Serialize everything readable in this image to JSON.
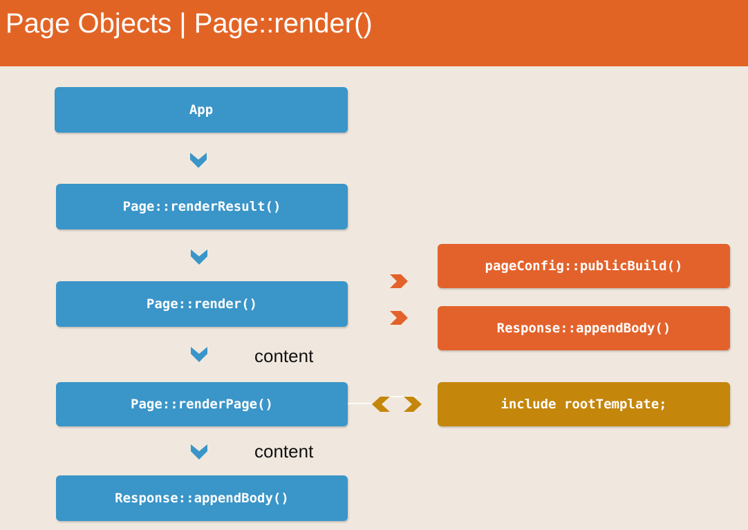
{
  "header": {
    "title": "Page Objects | Page::render()"
  },
  "flow": {
    "nodes": [
      {
        "id": "app",
        "label": "App"
      },
      {
        "id": "render-result",
        "label": "Page::renderResult()"
      },
      {
        "id": "render",
        "label": "Page::render()"
      },
      {
        "id": "render-page",
        "label": "Page::renderPage()"
      },
      {
        "id": "append-body-main",
        "label": "Response::appendBody()"
      }
    ],
    "side_nodes": [
      {
        "id": "public-build",
        "label": "pageConfig::publicBuild()"
      },
      {
        "id": "append-body-side",
        "label": "Response::appendBody()"
      },
      {
        "id": "root-template",
        "label": "include rootTemplate;"
      }
    ],
    "edge_labels": [
      "content",
      "content"
    ]
  },
  "colors": {
    "header": "#e26425",
    "background": "#f0e8de",
    "blue_box": "#3a95c8",
    "orange_box": "#e3622b",
    "gold_box": "#c4860b",
    "blue_arrow": "#3a95c8",
    "orange_arrow": "#e3622b",
    "gold_arrow": "#c4860b"
  },
  "icons": {
    "down_arrow": "chevron-down-icon",
    "right_arrow": "chevron-right-icon",
    "bidirectional_arrow": "double-chevron-icon"
  }
}
